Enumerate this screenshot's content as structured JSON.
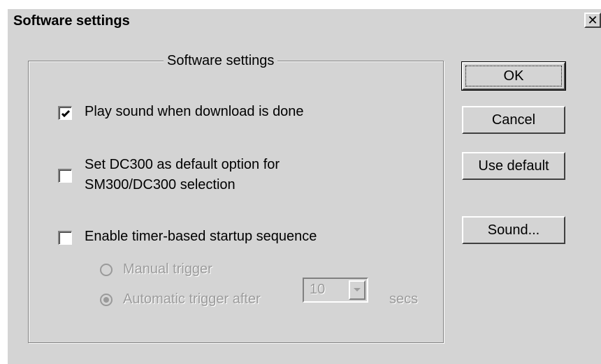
{
  "window": {
    "title": "Software settings",
    "close_label": "✕"
  },
  "group": {
    "title": "Software settings"
  },
  "options": {
    "play_sound": {
      "label": "Play sound when download is done",
      "checked": true
    },
    "default_dc300": {
      "label_line1": "Set DC300 as default option for",
      "label_line2": "SM300/DC300 selection",
      "checked": false
    },
    "timer_startup": {
      "label": "Enable timer-based startup sequence",
      "checked": false
    }
  },
  "trigger": {
    "manual_label": "Manual trigger",
    "automatic_label": "Automatic trigger after",
    "selected": "automatic",
    "delay_value": "10",
    "unit_label": "secs"
  },
  "buttons": {
    "ok": "OK",
    "cancel": "Cancel",
    "use_default": "Use default",
    "sound": "Sound..."
  }
}
